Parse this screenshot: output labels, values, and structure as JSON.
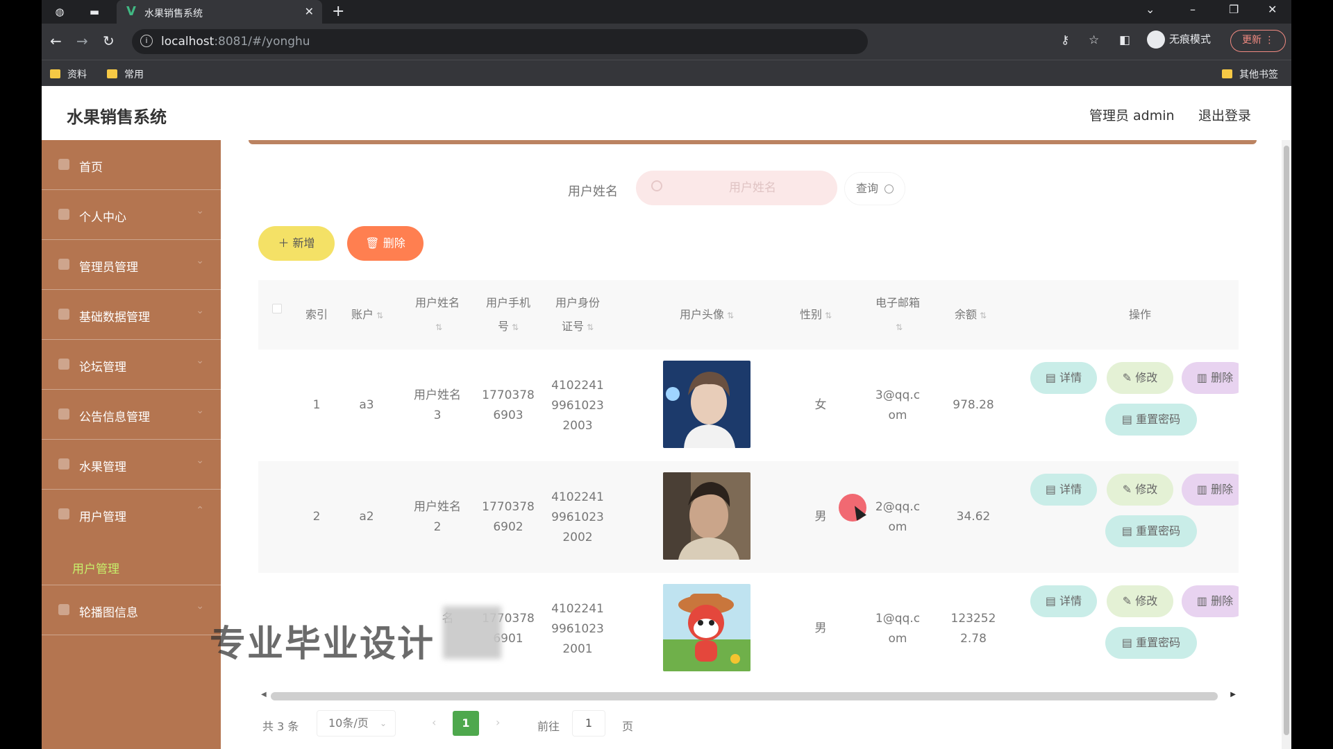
{
  "browser": {
    "tab_title": "水果销售系统",
    "tab_favicon": "V",
    "url_host": "localhost",
    "url_rest": ":8081/#/yonghu",
    "incognito_label": "无痕模式",
    "update_label": "更新",
    "bookmarks": [
      "资料",
      "常用"
    ],
    "other_bookmarks": "其他书签"
  },
  "app": {
    "title": "水果销售系统",
    "user_label": "管理员 admin",
    "logout": "退出登录"
  },
  "sidebar": {
    "items": [
      {
        "label": "首页"
      },
      {
        "label": "个人中心"
      },
      {
        "label": "管理员管理"
      },
      {
        "label": "基础数据管理"
      },
      {
        "label": "论坛管理"
      },
      {
        "label": "公告信息管理"
      },
      {
        "label": "水果管理"
      },
      {
        "label": "用户管理"
      },
      {
        "label": "轮播图信息"
      }
    ],
    "active_sub": "用户管理"
  },
  "search": {
    "label": "用户姓名",
    "placeholder": "用户姓名",
    "query_button": "查询"
  },
  "actions": {
    "add": "新增",
    "delete": "删除"
  },
  "table": {
    "headers": {
      "index": "索引",
      "account": "账户",
      "name": "用户姓名",
      "phone": "用户手机号",
      "id_card": "用户身份证号",
      "avatar": "用户头像",
      "gender": "性别",
      "email": "电子邮箱",
      "balance": "余额",
      "ops": "操作"
    },
    "rows": [
      {
        "index": "1",
        "account": "a3",
        "name_l1": "用户姓名",
        "name_l2": "3",
        "phone_l1": "1770378",
        "phone_l2": "6903",
        "id_l1": "4102241",
        "id_l2": "9961023",
        "id_l3": "2003",
        "gender": "女",
        "email_l1": "3@qq.c",
        "email_l2": "om",
        "balance_l1": "978.28",
        "balance_l2": ""
      },
      {
        "index": "2",
        "account": "a2",
        "name_l1": "用户姓名",
        "name_l2": "2",
        "phone_l1": "1770378",
        "phone_l2": "6902",
        "id_l1": "4102241",
        "id_l2": "9961023",
        "id_l3": "2002",
        "gender": "男",
        "email_l1": "2@qq.c",
        "email_l2": "om",
        "balance_l1": "34.62",
        "balance_l2": ""
      },
      {
        "index": "",
        "account": "",
        "name_l1": "名",
        "name_l2": "",
        "phone_l1": "1770378",
        "phone_l2": "6901",
        "id_l1": "4102241",
        "id_l2": "9961023",
        "id_l3": "2001",
        "gender": "男",
        "email_l1": "1@qq.c",
        "email_l2": "om",
        "balance_l1": "123252",
        "balance_l2": "2.78"
      }
    ],
    "ops": {
      "detail": "详情",
      "edit": "修改",
      "delete": "删除",
      "reset": "重置密码"
    }
  },
  "pager": {
    "total": "共 3 条",
    "page_size": "10条/页",
    "current": "1",
    "goto": "前往",
    "goto_value": "1",
    "page_suffix": "页"
  },
  "watermark": "专业毕业设计"
}
